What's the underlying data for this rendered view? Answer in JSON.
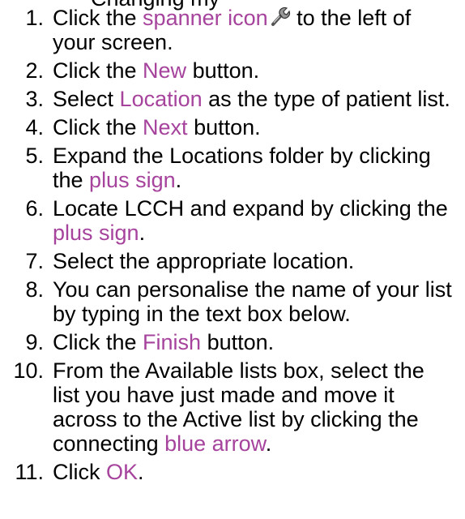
{
  "header_cutoff": "Changing my",
  "steps": [
    {
      "num": "1.",
      "parts": [
        {
          "text": "Click the ",
          "hl": false
        },
        {
          "text": "spanner icon",
          "hl": true
        },
        {
          "icon": "spanner-icon"
        },
        {
          "text": " to the left of your screen.",
          "hl": false
        }
      ]
    },
    {
      "num": "2.",
      "parts": [
        {
          "text": "Click the ",
          "hl": false
        },
        {
          "text": "New",
          "hl": true
        },
        {
          "text": " button.",
          "hl": false
        }
      ]
    },
    {
      "num": "3.",
      "parts": [
        {
          "text": "Select ",
          "hl": false
        },
        {
          "text": "Location",
          "hl": true
        },
        {
          "text": " as the type of patient list.",
          "hl": false
        }
      ]
    },
    {
      "num": "4.",
      "parts": [
        {
          "text": "Click the ",
          "hl": false
        },
        {
          "text": "Next",
          "hl": true
        },
        {
          "text": " button.",
          "hl": false
        }
      ]
    },
    {
      "num": "5.",
      "parts": [
        {
          "text": "Expand the Locations folder by clicking the ",
          "hl": false
        },
        {
          "text": "plus sign",
          "hl": true
        },
        {
          "text": ".",
          "hl": false
        }
      ]
    },
    {
      "num": "6.",
      "parts": [
        {
          "text": "Locate LCCH and expand by clicking the ",
          "hl": false
        },
        {
          "text": "plus sign",
          "hl": true
        },
        {
          "text": ".",
          "hl": false
        }
      ]
    },
    {
      "num": "7.",
      "parts": [
        {
          "text": "Select the appropriate location.",
          "hl": false
        }
      ]
    },
    {
      "num": "8.",
      "parts": [
        {
          "text": "You can personalise the name of your list by typing in the text box below.",
          "hl": false
        }
      ]
    },
    {
      "num": "9.",
      "parts": [
        {
          "text": "Click the ",
          "hl": false
        },
        {
          "text": "Finish",
          "hl": true
        },
        {
          "text": " button.",
          "hl": false
        }
      ]
    },
    {
      "num": "10.",
      "parts": [
        {
          "text": "From the Available lists box, select the list you have just made and move it across to the Active list by clicking the connecting ",
          "hl": false
        },
        {
          "text": "blue arrow",
          "hl": true
        },
        {
          "text": ".",
          "hl": false
        }
      ]
    },
    {
      "num": "11.",
      "parts": [
        {
          "text": "Click ",
          "hl": false
        },
        {
          "text": "OK",
          "hl": true
        },
        {
          "text": ".",
          "hl": false
        }
      ]
    }
  ],
  "colors": {
    "highlight": "#a6439c",
    "text": "#000000"
  }
}
